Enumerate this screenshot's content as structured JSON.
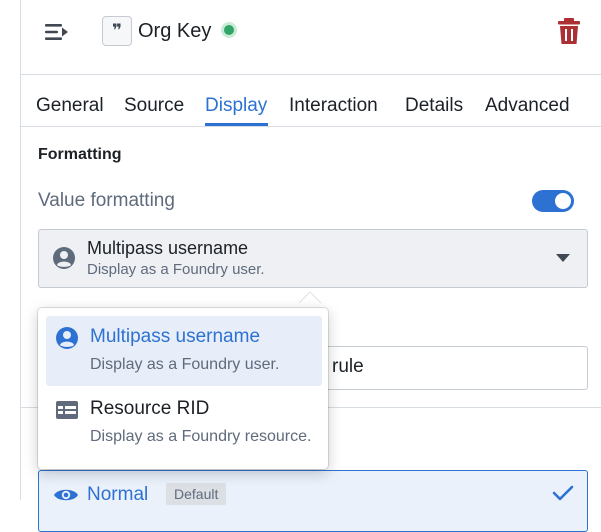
{
  "header": {
    "quote_glyph": "❞",
    "title": "Org Key",
    "status": "active"
  },
  "tabs": [
    {
      "label": "General"
    },
    {
      "label": "Source"
    },
    {
      "label": "Display",
      "active": true
    },
    {
      "label": "Interaction"
    },
    {
      "label": "Details"
    },
    {
      "label": "Advanced"
    }
  ],
  "formatting": {
    "section_title": "Formatting",
    "value_formatting_label": "Value formatting",
    "toggle_on": true,
    "select": {
      "title": "Multipass username",
      "subtitle": "Display as a Foundry user.",
      "icon": "user-circle-icon"
    }
  },
  "behind": {
    "input_text": "rule"
  },
  "dropdown": {
    "items": [
      {
        "title": "Multipass username",
        "subtitle": "Display as a Foundry user.",
        "icon": "user-circle-icon",
        "selected": true
      },
      {
        "title": "Resource RID",
        "subtitle": "Display as a Foundry resource.",
        "icon": "table-icon",
        "selected": false
      }
    ]
  },
  "visibility": {
    "label": "Normal",
    "tag": "Default",
    "icon": "eye-icon"
  },
  "colors": {
    "accent": "#2d72d2",
    "danger": "#ac2f33",
    "success": "#32a467"
  }
}
